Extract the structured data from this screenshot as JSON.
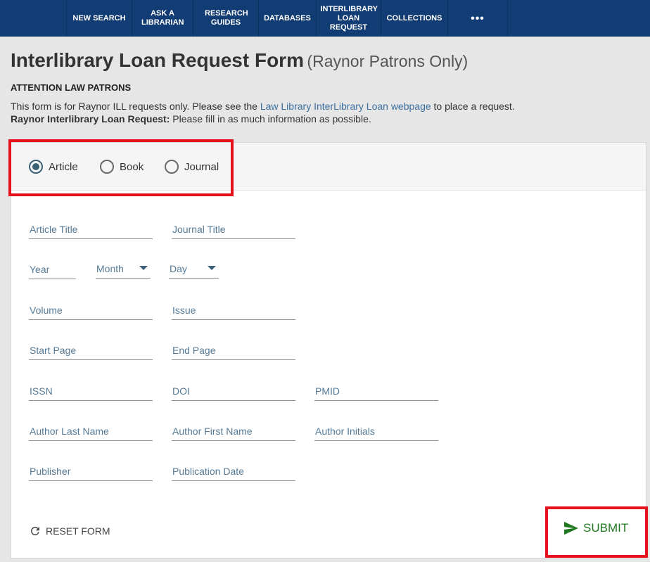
{
  "nav": {
    "items": [
      "NEW SEARCH",
      "ASK A LIBRARIAN",
      "RESEARCH GUIDES",
      "DATABASES",
      "INTERLIBRARY LOAN REQUEST",
      "COLLECTIONS"
    ],
    "more": "•••"
  },
  "header": {
    "title": "Interlibrary Loan Request Form",
    "subtitle": "(Raynor Patrons Only)",
    "attention": "ATTENTION LAW PATRONS",
    "info_pre": "This form is for Raynor ILL requests only. Please see the ",
    "info_link": "Law Library InterLibrary Loan webpage",
    "info_post": " to place a request.",
    "request_bold": "Raynor Interlibrary Loan Request:",
    "request_text": " Please fill in as much information as possible."
  },
  "request_types": {
    "selected": "Article",
    "options": [
      "Article",
      "Book",
      "Journal"
    ]
  },
  "fields": {
    "article_title": "Article Title",
    "journal_title": "Journal Title",
    "year": "Year",
    "month": "Month",
    "day": "Day",
    "volume": "Volume",
    "issue": "Issue",
    "start_page": "Start Page",
    "end_page": "End Page",
    "issn": "ISSN",
    "doi": "DOI",
    "pmid": "PMID",
    "author_last": "Author Last Name",
    "author_first": "Author First Name",
    "author_initials": "Author Initials",
    "publisher": "Publisher",
    "publication_date": "Publication Date"
  },
  "actions": {
    "reset": "RESET FORM",
    "submit": "SUBMIT"
  },
  "colors": {
    "nav_bg": "#123c74",
    "highlight": "#e5111b",
    "submit": "#1f7a1f",
    "link": "#3b6fa0"
  }
}
